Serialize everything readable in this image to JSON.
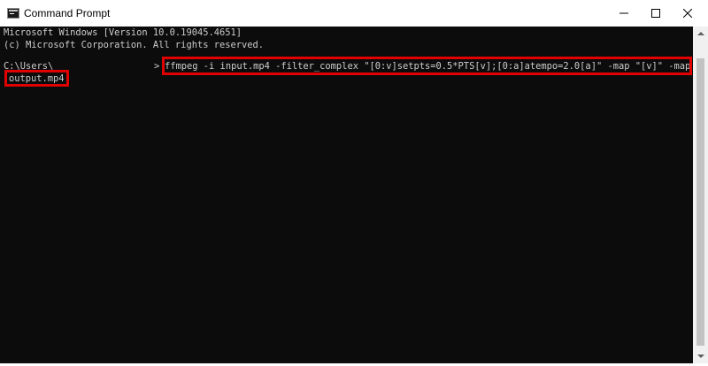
{
  "window": {
    "title": "Command Prompt",
    "icon": "console-icon",
    "controls": {
      "minimize_icon": "minimize-icon",
      "maximize_icon": "maximize-icon",
      "close_icon": "close-icon"
    }
  },
  "console": {
    "lines": [
      "Microsoft Windows [Version 10.0.19045.4651]",
      "(c) Microsoft Corporation. All rights reserved."
    ],
    "prompt_path": "C:\\Users\\",
    "prompt_arrow": ">",
    "command": "ffmpeg -i input.mp4 -filter_complex \"[0:v]setpts=0.5*PTS[v];[0:a]atempo=2.0[a]\" -map \"[v]\" -map \"[a]\"",
    "command_continuation": "output.mp4"
  },
  "colors": {
    "console_background": "#0c0c0c",
    "console_text": "#cccccc",
    "highlight": "#e00000",
    "titlebar": "#ffffff"
  }
}
